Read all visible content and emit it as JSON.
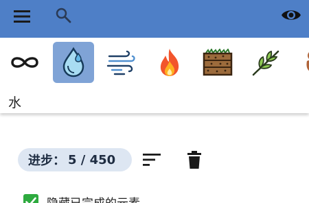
{
  "app_bar": {
    "background": "#4e7fc7",
    "icons": [
      "menu-icon",
      "search-icon",
      "eye-icon"
    ]
  },
  "elements": {
    "items": [
      {
        "name": "infinity",
        "icon": "infinity-icon"
      },
      {
        "name": "水",
        "icon": "water-drop-icon",
        "selected": true
      },
      {
        "name": "wind",
        "icon": "wind-icon"
      },
      {
        "name": "fire",
        "icon": "fire-icon"
      },
      {
        "name": "earth",
        "icon": "earth-soil-icon"
      },
      {
        "name": "plant",
        "icon": "plant-icon"
      },
      {
        "name": "more",
        "icon": "partial-element-icon"
      }
    ],
    "selected_name": "水",
    "selected_color": "#7fa3d6"
  },
  "progress": {
    "label": "进步：",
    "value": "5 / 450",
    "current": 5,
    "total": 450
  },
  "hide_completed": {
    "label": "隐藏已完成的元素",
    "checked": true,
    "color": "#2eaa3f"
  }
}
